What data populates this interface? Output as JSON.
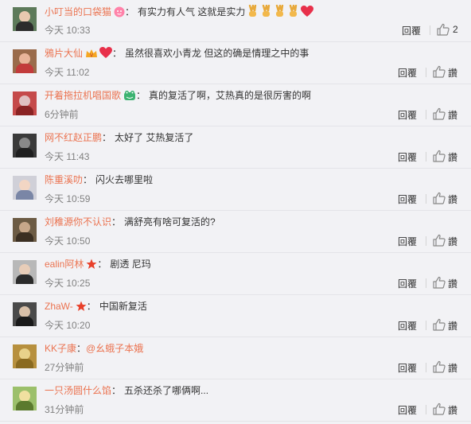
{
  "comments": [
    {
      "user": "小叮当的口袋猫",
      "badge": "vip-cat-badge",
      "text": "有实力有人气  这就是实力",
      "emoji": [
        "victory",
        "victory",
        "victory",
        "victory",
        "heart"
      ],
      "time": "今天 10:33",
      "reply": "回覆",
      "like": "2",
      "avatar_colors": [
        "#5d7a5a",
        "#e8c9b0",
        "#2c2c2c"
      ]
    },
    {
      "user": "鴉片大仙",
      "badge": "vip-crown-badge",
      "text": "虽然很喜欢小青龙 但这的确是情理之中的事",
      "emoji_before": "heart",
      "time": "今天 11:02",
      "reply": "回覆",
      "like": "讚",
      "avatar_colors": [
        "#9a6b4b",
        "#e9b59a",
        "#c23b3b"
      ]
    },
    {
      "user": "开着拖拉机唱国歌",
      "badge": "green-frog-badge",
      "text": "真的复活了啊，艾热真的是很厉害的啊",
      "time": "6分钟前",
      "reply": "回覆",
      "like": "讚",
      "avatar_colors": [
        "#c54a4a",
        "#e0c0c0",
        "#8a2323"
      ]
    },
    {
      "user": "网不红赵正鹏",
      "text": "太好了 艾热复活了",
      "time": "今天 11:43",
      "reply": "回覆",
      "like": "讚",
      "avatar_colors": [
        "#3a3a3a",
        "#888888",
        "#1f1f1f"
      ]
    },
    {
      "user": "陈重溪叻",
      "text": "闪火去哪里啦",
      "time": "今天 10:59",
      "reply": "回覆",
      "like": "讚",
      "avatar_colors": [
        "#d0d0d8",
        "#f2d6c4",
        "#7a86a6"
      ]
    },
    {
      "user": "刘稚源你不认识",
      "text": "满舒亮有啥可复活的?",
      "time": "今天 10:50",
      "reply": "回覆",
      "like": "讚",
      "avatar_colors": [
        "#6c5b44",
        "#c7a78a",
        "#3b2f22"
      ]
    },
    {
      "user": "ealin阿林",
      "badge": "star-badge",
      "text": "剧透  尼玛",
      "time": "今天 10:25",
      "reply": "回覆",
      "like": "讚",
      "avatar_colors": [
        "#b8b8b8",
        "#e8cdb8",
        "#2b2b2b"
      ]
    },
    {
      "user": "ZhaW-",
      "badge": "star-badge",
      "text": "中国新复活",
      "time": "今天 10:20",
      "reply": "回覆",
      "like": "讚",
      "avatar_colors": [
        "#4a4a4a",
        "#d8c0a8",
        "#1a1a1a"
      ]
    },
    {
      "user": "KK子康",
      "text": "",
      "mention": "@幺蛾子本娥",
      "time": "27分钟前",
      "reply": "回覆",
      "like": "讚",
      "avatar_colors": [
        "#b7903e",
        "#e8d28a",
        "#8a6a20"
      ]
    },
    {
      "user": "一只汤圆什么馅",
      "text": "五杀还杀了哪俩啊...",
      "time": "31分钟前",
      "reply": "回覆",
      "like": "讚",
      "avatar_colors": [
        "#9cc06b",
        "#f0e0a0",
        "#5b7a2e"
      ]
    }
  ]
}
